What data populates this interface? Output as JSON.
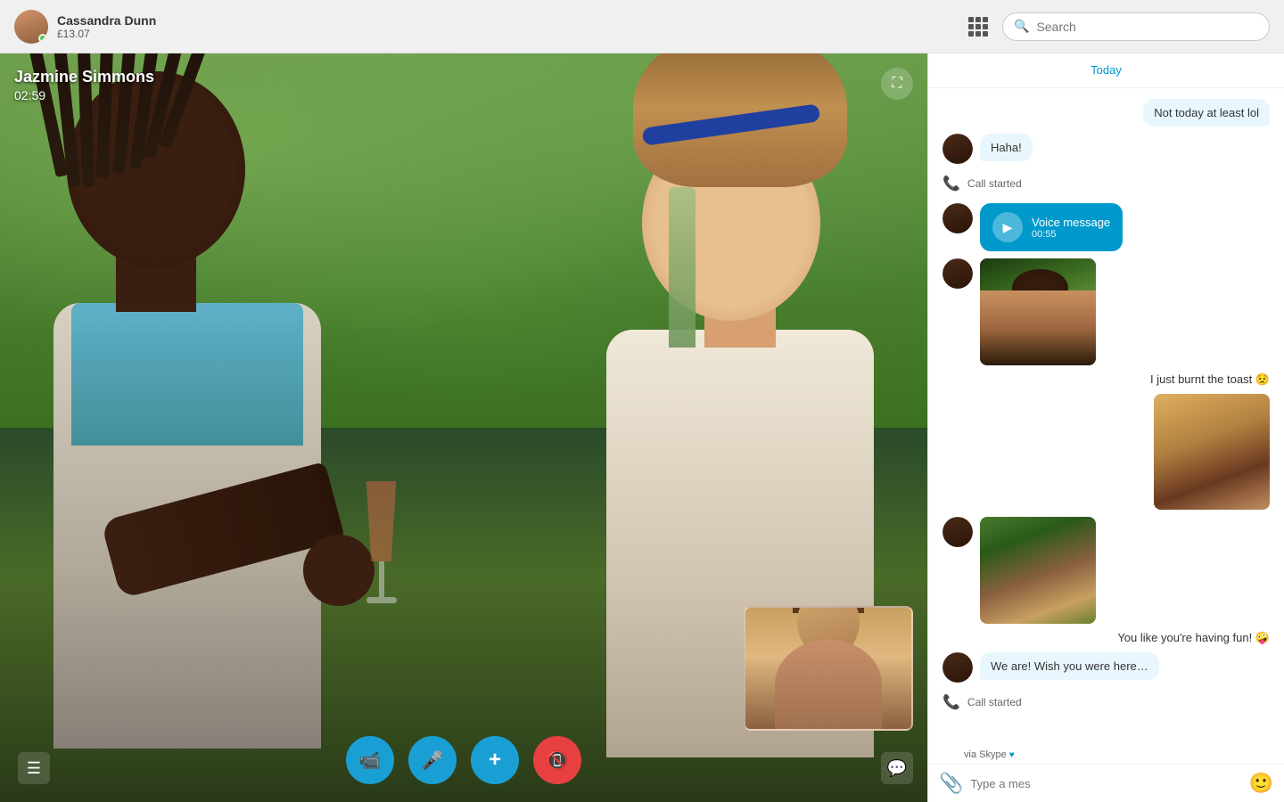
{
  "topbar": {
    "user_name": "Cassandra Dunn",
    "user_credit": "£13.07",
    "search_placeholder": "Search"
  },
  "call": {
    "contact_name": "Jazmine Simmons",
    "timer": "02:59",
    "expand_btn_label": "⛶"
  },
  "controls": {
    "video_label": "📷",
    "mic_label": "🎤",
    "add_label": "+",
    "end_label": "✕"
  },
  "chat": {
    "date_label": "Today",
    "messages": [
      {
        "type": "right-bubble",
        "text": "Not today at least lol"
      },
      {
        "type": "left-bubble",
        "text": "Haha!",
        "avatar": "dark"
      },
      {
        "type": "system",
        "text": "Call started"
      },
      {
        "type": "voice",
        "label": "Voice message",
        "duration": "00:55"
      },
      {
        "type": "img-left",
        "alt": "photo"
      },
      {
        "type": "text-right",
        "text": "I just burnt the toast 😟"
      },
      {
        "type": "img-right",
        "alt": "burnt toast photo"
      },
      {
        "type": "img-left-2",
        "alt": "group photo"
      },
      {
        "type": "text-right-2",
        "text": "You like you're having fun! 🤪"
      },
      {
        "type": "left-bubble-2",
        "text": "We are! Wish you were here…"
      },
      {
        "type": "system-2",
        "text": "Call started"
      }
    ],
    "footer": {
      "via_label": "via Skype",
      "type_placeholder": "Type a mes"
    }
  }
}
